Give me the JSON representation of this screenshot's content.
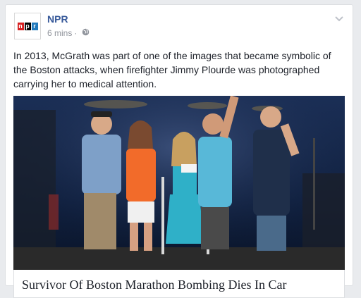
{
  "post": {
    "page_name": "NPR",
    "avatar_letters": [
      "n",
      "p",
      "r"
    ],
    "timestamp": "6 mins",
    "separator": "·",
    "audience_icon": "globe-icon",
    "menu_icon": "chevron-down-icon",
    "text": "In 2013, McGrath was part of one of the images that became symbolic of the Boston attacks, when firefighter Jimmy Plourde was photographed carrying her to medical attention."
  },
  "link": {
    "title": "Survivor Of Boston Marathon Bombing Dies In Car"
  },
  "colors": {
    "link_blue": "#365899",
    "npr_red": "#d62021",
    "npr_black": "#000000",
    "npr_blue": "#237bbd",
    "meta_gray": "#90949c",
    "feed_background": "#e9ebee"
  }
}
